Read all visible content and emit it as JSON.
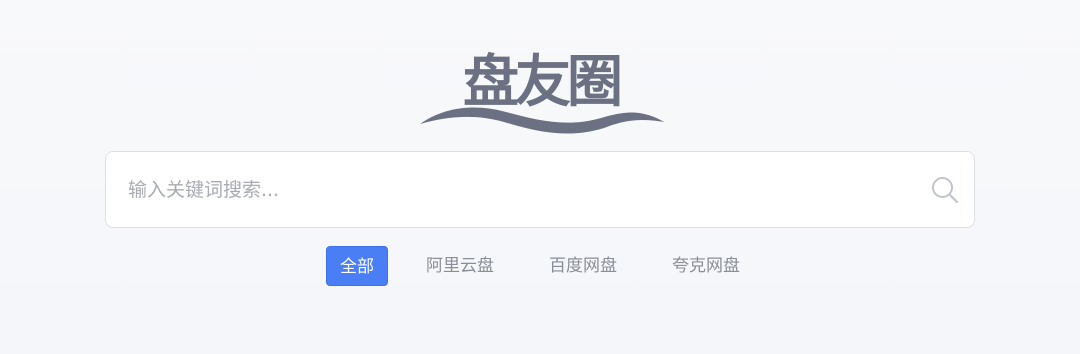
{
  "brand": {
    "logo_text": "盘友圈"
  },
  "search": {
    "placeholder": "输入关键词搜索...",
    "value": "",
    "icon": "search-icon"
  },
  "tabs": [
    {
      "label": "全部",
      "active": true
    },
    {
      "label": "阿里云盘",
      "active": false
    },
    {
      "label": "百度网盘",
      "active": false
    },
    {
      "label": "夸克网盘",
      "active": false
    }
  ],
  "colors": {
    "logo": "#6b7182",
    "accent": "#4a7ef5",
    "tab_text": "#8a8e98",
    "background": "#f6f7fa"
  }
}
